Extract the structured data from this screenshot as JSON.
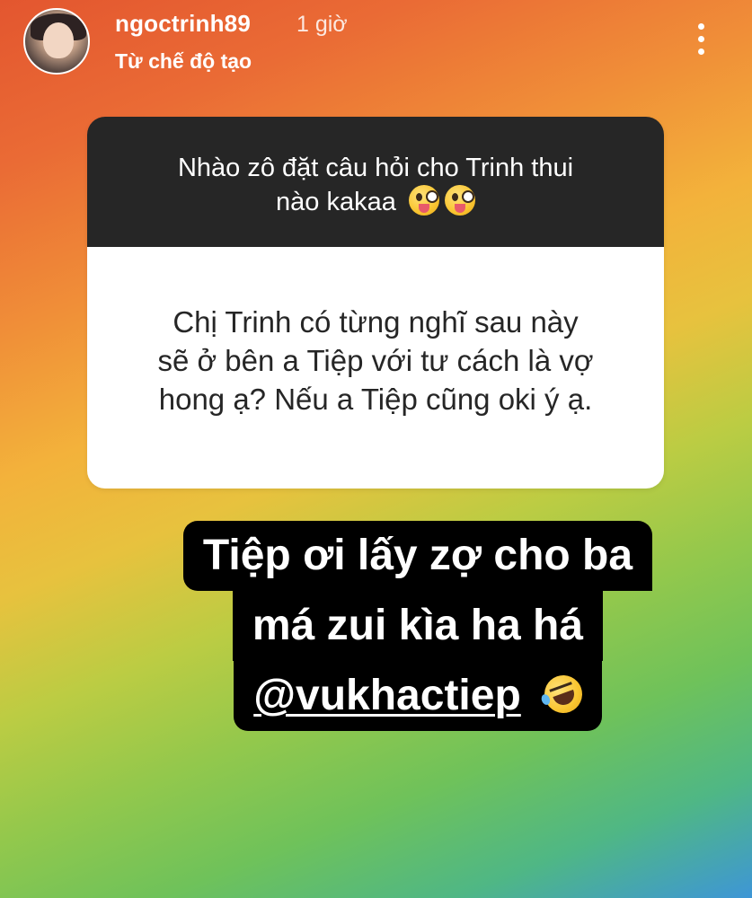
{
  "header": {
    "username": "ngoctrinh89",
    "timestamp": "1 giờ",
    "subtitle": "Từ chế độ tạo",
    "avatar_icon": "profile-photo",
    "more_icon": "vertical-ellipsis-icon"
  },
  "question_sticker": {
    "prompt_line1": "Nhào zô đặt câu hỏi cho Trinh thui",
    "prompt_line2": "nào kakaa",
    "prompt_emoji": "zany-face-emoji",
    "answer_line1": "Chị Trinh có từng nghĩ sau này",
    "answer_line2": "sẽ ở bên a Tiệp với tư cách là vợ",
    "answer_line3": "hong ạ? Nếu a Tiệp cũng oki ý ạ."
  },
  "caption": {
    "line1": "Tiệp ơi lấy zợ cho ba",
    "line2": "má zui kìa ha há",
    "mention": "@vukhactiep",
    "emoji": "rolling-on-floor-laughing-emoji"
  },
  "colors": {
    "prompt_bg": "#262626",
    "answer_bg": "#ffffff",
    "caption_bg": "#000000",
    "text_light": "#ffffff",
    "text_dark": "#262626"
  }
}
